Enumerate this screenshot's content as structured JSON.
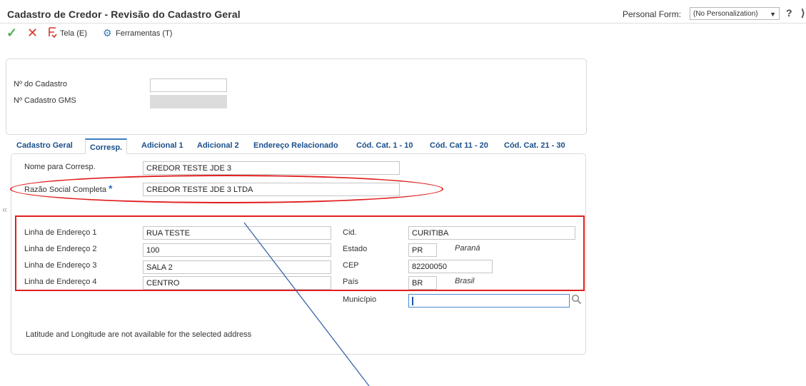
{
  "header": {
    "title": "Cadastro de Credor - Revisão do Cadastro Geral",
    "personal_form_label": "Personal Form:",
    "personal_form_value": "(No Personalization)",
    "help": "?"
  },
  "toolbar": {
    "tela": "Tela (E)",
    "ferramentas": "Ferramentas (T)"
  },
  "top_form": {
    "cadastro_label": "Nº do Cadastro",
    "cadastro_value": "",
    "gms_label": "Nº Cadastro GMS",
    "gms_value": ""
  },
  "tabs": [
    {
      "label": "Cadastro Geral"
    },
    {
      "label": "Corresp."
    },
    {
      "label": "Adicional 1"
    },
    {
      "label": "Adicional 2"
    },
    {
      "label": "Endereço Relacionado"
    },
    {
      "label": "Cód. Cat. 1 - 10"
    },
    {
      "label": "Cód. Cat 11 - 20"
    },
    {
      "label": "Cód. Cat. 21 - 30"
    }
  ],
  "corresp": {
    "nome_label": "Nome para Corresp.",
    "nome_value": "CREDOR TESTE JDE 3",
    "razao_label": "Razão Social Completa",
    "razao_value": "CREDOR TESTE JDE 3 LTDA",
    "linha1_label": "Linha de Endereço 1",
    "linha1_value": "RUA TESTE",
    "linha2_label": "Linha de Endereço 2",
    "linha2_value": "100",
    "linha3_label": "Linha de Endereço 3",
    "linha3_value": "SALA 2",
    "linha4_label": "Linha de Endereço 4",
    "linha4_value": "CENTRO",
    "cid_label": "Cid.",
    "cid_value": "CURITIBA",
    "estado_label": "Estado",
    "estado_value": "PR",
    "estado_desc": "Paraná",
    "cep_label": "CEP",
    "cep_value": "82200050",
    "pais_label": "País",
    "pais_value": "BR",
    "pais_desc": "Brasil",
    "municipio_label": "Município",
    "municipio_value": "",
    "latlong_note": "Latitude and Longitude are not available for the selected address"
  },
  "colors": {
    "annotation_red": "#e02020",
    "tab_text": "#1a4f8b",
    "annotation_line": "#3b63a8"
  }
}
